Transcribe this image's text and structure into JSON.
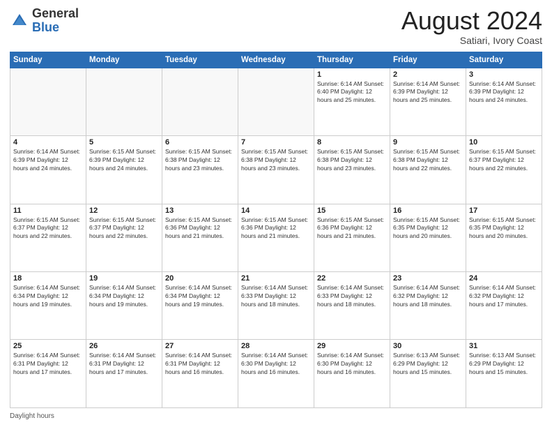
{
  "logo": {
    "general": "General",
    "blue": "Blue"
  },
  "title": {
    "month": "August 2024",
    "location": "Satiari, Ivory Coast"
  },
  "weekdays": [
    "Sunday",
    "Monday",
    "Tuesday",
    "Wednesday",
    "Thursday",
    "Friday",
    "Saturday"
  ],
  "footer": "Daylight hours",
  "weeks": [
    [
      {
        "day": "",
        "info": ""
      },
      {
        "day": "",
        "info": ""
      },
      {
        "day": "",
        "info": ""
      },
      {
        "day": "",
        "info": ""
      },
      {
        "day": "1",
        "info": "Sunrise: 6:14 AM\nSunset: 6:40 PM\nDaylight: 12 hours\nand 25 minutes."
      },
      {
        "day": "2",
        "info": "Sunrise: 6:14 AM\nSunset: 6:39 PM\nDaylight: 12 hours\nand 25 minutes."
      },
      {
        "day": "3",
        "info": "Sunrise: 6:14 AM\nSunset: 6:39 PM\nDaylight: 12 hours\nand 24 minutes."
      }
    ],
    [
      {
        "day": "4",
        "info": "Sunrise: 6:14 AM\nSunset: 6:39 PM\nDaylight: 12 hours\nand 24 minutes."
      },
      {
        "day": "5",
        "info": "Sunrise: 6:15 AM\nSunset: 6:39 PM\nDaylight: 12 hours\nand 24 minutes."
      },
      {
        "day": "6",
        "info": "Sunrise: 6:15 AM\nSunset: 6:38 PM\nDaylight: 12 hours\nand 23 minutes."
      },
      {
        "day": "7",
        "info": "Sunrise: 6:15 AM\nSunset: 6:38 PM\nDaylight: 12 hours\nand 23 minutes."
      },
      {
        "day": "8",
        "info": "Sunrise: 6:15 AM\nSunset: 6:38 PM\nDaylight: 12 hours\nand 23 minutes."
      },
      {
        "day": "9",
        "info": "Sunrise: 6:15 AM\nSunset: 6:38 PM\nDaylight: 12 hours\nand 22 minutes."
      },
      {
        "day": "10",
        "info": "Sunrise: 6:15 AM\nSunset: 6:37 PM\nDaylight: 12 hours\nand 22 minutes."
      }
    ],
    [
      {
        "day": "11",
        "info": "Sunrise: 6:15 AM\nSunset: 6:37 PM\nDaylight: 12 hours\nand 22 minutes."
      },
      {
        "day": "12",
        "info": "Sunrise: 6:15 AM\nSunset: 6:37 PM\nDaylight: 12 hours\nand 22 minutes."
      },
      {
        "day": "13",
        "info": "Sunrise: 6:15 AM\nSunset: 6:36 PM\nDaylight: 12 hours\nand 21 minutes."
      },
      {
        "day": "14",
        "info": "Sunrise: 6:15 AM\nSunset: 6:36 PM\nDaylight: 12 hours\nand 21 minutes."
      },
      {
        "day": "15",
        "info": "Sunrise: 6:15 AM\nSunset: 6:36 PM\nDaylight: 12 hours\nand 21 minutes."
      },
      {
        "day": "16",
        "info": "Sunrise: 6:15 AM\nSunset: 6:35 PM\nDaylight: 12 hours\nand 20 minutes."
      },
      {
        "day": "17",
        "info": "Sunrise: 6:15 AM\nSunset: 6:35 PM\nDaylight: 12 hours\nand 20 minutes."
      }
    ],
    [
      {
        "day": "18",
        "info": "Sunrise: 6:14 AM\nSunset: 6:34 PM\nDaylight: 12 hours\nand 19 minutes."
      },
      {
        "day": "19",
        "info": "Sunrise: 6:14 AM\nSunset: 6:34 PM\nDaylight: 12 hours\nand 19 minutes."
      },
      {
        "day": "20",
        "info": "Sunrise: 6:14 AM\nSunset: 6:34 PM\nDaylight: 12 hours\nand 19 minutes."
      },
      {
        "day": "21",
        "info": "Sunrise: 6:14 AM\nSunset: 6:33 PM\nDaylight: 12 hours\nand 18 minutes."
      },
      {
        "day": "22",
        "info": "Sunrise: 6:14 AM\nSunset: 6:33 PM\nDaylight: 12 hours\nand 18 minutes."
      },
      {
        "day": "23",
        "info": "Sunrise: 6:14 AM\nSunset: 6:32 PM\nDaylight: 12 hours\nand 18 minutes."
      },
      {
        "day": "24",
        "info": "Sunrise: 6:14 AM\nSunset: 6:32 PM\nDaylight: 12 hours\nand 17 minutes."
      }
    ],
    [
      {
        "day": "25",
        "info": "Sunrise: 6:14 AM\nSunset: 6:31 PM\nDaylight: 12 hours\nand 17 minutes."
      },
      {
        "day": "26",
        "info": "Sunrise: 6:14 AM\nSunset: 6:31 PM\nDaylight: 12 hours\nand 17 minutes."
      },
      {
        "day": "27",
        "info": "Sunrise: 6:14 AM\nSunset: 6:31 PM\nDaylight: 12 hours\nand 16 minutes."
      },
      {
        "day": "28",
        "info": "Sunrise: 6:14 AM\nSunset: 6:30 PM\nDaylight: 12 hours\nand 16 minutes."
      },
      {
        "day": "29",
        "info": "Sunrise: 6:14 AM\nSunset: 6:30 PM\nDaylight: 12 hours\nand 16 minutes."
      },
      {
        "day": "30",
        "info": "Sunrise: 6:13 AM\nSunset: 6:29 PM\nDaylight: 12 hours\nand 15 minutes."
      },
      {
        "day": "31",
        "info": "Sunrise: 6:13 AM\nSunset: 6:29 PM\nDaylight: 12 hours\nand 15 minutes."
      }
    ]
  ]
}
